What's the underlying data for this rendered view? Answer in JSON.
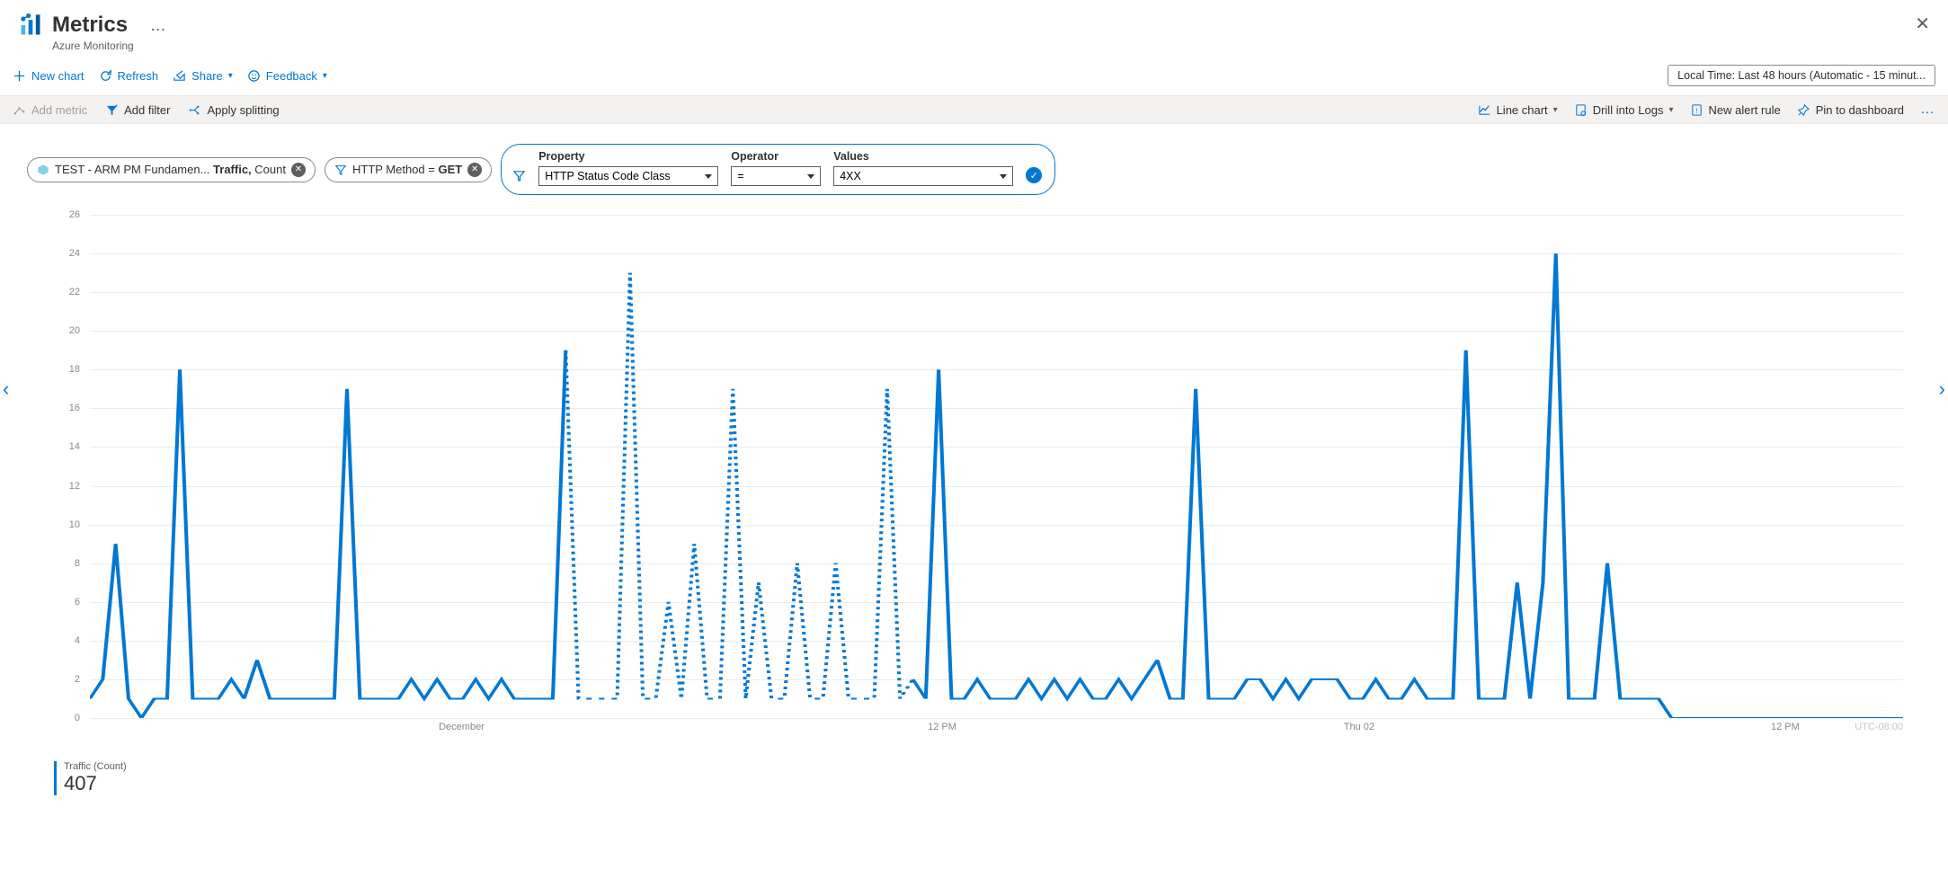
{
  "header": {
    "title": "Metrics",
    "subtitle": "Azure Monitoring"
  },
  "commands": {
    "new_chart": "New chart",
    "refresh": "Refresh",
    "share": "Share",
    "feedback": "Feedback",
    "time_range": "Local Time: Last 48 hours (Automatic - 15 minut..."
  },
  "toolbar": {
    "add_metric": "Add metric",
    "add_filter": "Add filter",
    "apply_splitting": "Apply splitting",
    "chart_type": "Line chart",
    "drill_logs": "Drill into Logs",
    "new_alert": "New alert rule",
    "pin": "Pin to dashboard"
  },
  "pills": {
    "metric_text_a": "TEST - ARM PM Fundamen... ",
    "metric_text_b": "Traffic,",
    "metric_text_c": " Count",
    "filter_text_a": "HTTP Method = ",
    "filter_text_b": "GET"
  },
  "filter_editor": {
    "property_label": "Property",
    "property_value": "HTTP Status Code Class",
    "operator_label": "Operator",
    "operator_value": "=",
    "values_label": "Values",
    "values_value": "4XX"
  },
  "legend": {
    "series": "Traffic (Count)",
    "value": "407"
  },
  "chart_data": {
    "type": "line",
    "ylabel": "",
    "xlabel": "",
    "ylim": [
      0,
      26
    ],
    "y_ticks": [
      0,
      2,
      4,
      6,
      8,
      10,
      12,
      14,
      16,
      18,
      20,
      22,
      24,
      26
    ],
    "x_ticks": [
      {
        "pos_pct": 20.5,
        "label": "December"
      },
      {
        "pos_pct": 47,
        "label": "12 PM"
      },
      {
        "pos_pct": 70,
        "label": "Thu 02"
      },
      {
        "pos_pct": 93.5,
        "label": "12 PM"
      }
    ],
    "timezone": "UTC-08:00",
    "series": [
      {
        "name": "Traffic (Count)",
        "color": "#0078d4"
      }
    ],
    "x": [
      0,
      1,
      2,
      3,
      4,
      5,
      6,
      7,
      8,
      9,
      10,
      11,
      12,
      13,
      14,
      15,
      16,
      17,
      18,
      19,
      20,
      21,
      22,
      23,
      24,
      25,
      26,
      27,
      28,
      29,
      30,
      31,
      32,
      33,
      34,
      35,
      36,
      37,
      38,
      39,
      40,
      41,
      42,
      43,
      44,
      45,
      46,
      47,
      48,
      49,
      50,
      51,
      52,
      53,
      54,
      55,
      56,
      57,
      58,
      59,
      60,
      61,
      62,
      63,
      64,
      65,
      66,
      67,
      68,
      69,
      70,
      71,
      72,
      73,
      74,
      75,
      76,
      77,
      78,
      79,
      80,
      81,
      82,
      83,
      84,
      85,
      86,
      87,
      88,
      89,
      90,
      91,
      92,
      93,
      94,
      95,
      96,
      97,
      98,
      99,
      100,
      101,
      102,
      103,
      104,
      105,
      106,
      107,
      108,
      109,
      110,
      111,
      112,
      113,
      114,
      115,
      116,
      117,
      118,
      119,
      120,
      121,
      122,
      123,
      124,
      125,
      126,
      127,
      128,
      129,
      130,
      131,
      132,
      133,
      134,
      135,
      136,
      137,
      138,
      139,
      140,
      141
    ],
    "values": [
      1,
      2,
      9,
      1,
      0,
      1,
      1,
      18,
      1,
      1,
      1,
      2,
      1,
      3,
      1,
      1,
      1,
      1,
      1,
      1,
      17,
      1,
      1,
      1,
      1,
      2,
      1,
      2,
      1,
      1,
      2,
      1,
      2,
      1,
      1,
      1,
      1,
      19,
      1,
      1,
      1,
      1,
      23,
      1,
      1,
      6,
      1,
      9,
      1,
      1,
      17,
      1,
      7,
      1,
      1,
      8,
      1,
      1,
      8,
      1,
      1,
      1,
      17,
      1,
      2,
      1,
      18,
      1,
      1,
      2,
      1,
      1,
      1,
      2,
      1,
      2,
      1,
      2,
      1,
      1,
      2,
      1,
      2,
      3,
      1,
      1,
      17,
      1,
      1,
      1,
      2,
      2,
      1,
      2,
      1,
      2,
      2,
      2,
      1,
      1,
      2,
      1,
      1,
      2,
      1,
      1,
      1,
      19,
      1,
      1,
      1,
      7,
      1,
      7,
      24,
      1,
      1,
      1,
      8,
      1,
      1,
      1,
      1,
      0,
      0,
      0,
      0,
      0,
      0,
      0,
      0,
      0,
      0,
      0,
      0,
      0,
      0,
      0,
      0,
      0,
      0,
      0
    ],
    "dashed_ranges": [
      [
        37,
        64
      ]
    ]
  }
}
